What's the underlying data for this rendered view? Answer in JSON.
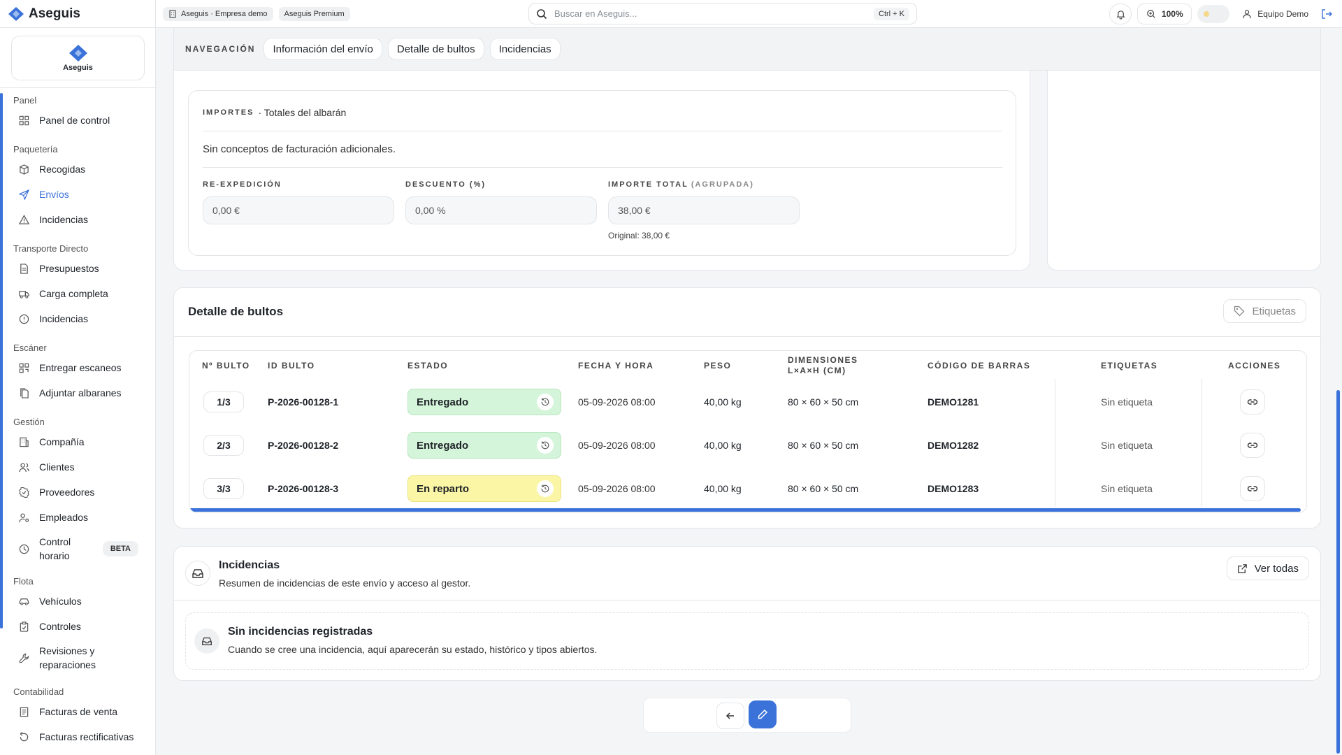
{
  "topbar": {
    "brand": "Aseguis",
    "company_chip": "Aseguis · Empresa demo",
    "plan_chip": "Aseguis Premium",
    "search_placeholder": "Buscar en Aseguis...",
    "search_shortcut": "Ctrl + K",
    "zoom": "100%",
    "user": "Equipo Demo"
  },
  "sidebar": {
    "logo_text": "Aseguis",
    "groups": [
      {
        "label": "Panel",
        "items": [
          "Panel de control"
        ]
      },
      {
        "label": "Paquetería",
        "items": [
          "Recogidas",
          "Envíos",
          "Incidencias"
        ]
      },
      {
        "label": "Transporte Directo",
        "items": [
          "Presupuestos",
          "Carga completa",
          "Incidencias"
        ]
      },
      {
        "label": "Escáner",
        "items": [
          "Entregar escaneos",
          "Adjuntar albaranes"
        ]
      },
      {
        "label": "Gestión",
        "items": [
          "Compañía",
          "Clientes",
          "Proveedores",
          "Empleados",
          "Control horario"
        ]
      },
      {
        "label": "Flota",
        "items": [
          "Vehículos",
          "Controles",
          "Revisiones y reparaciones"
        ]
      },
      {
        "label": "Contabilidad",
        "items": [
          "Facturas de venta",
          "Facturas rectificativas"
        ]
      }
    ],
    "beta_badge": "BETA"
  },
  "nav": {
    "label": "NAVEGACIÓN",
    "tabs": [
      "Información del envío",
      "Detalle de bultos",
      "Incidencias"
    ]
  },
  "importes": {
    "title": "IMPORTES",
    "subtitle": "· Totales del albarán",
    "empty": "Sin conceptos de facturación adicionales.",
    "reexp_label": "RE-EXPEDICIÓN",
    "reexp_value": "0,00 €",
    "descuento_label": "DESCUENTO (%)",
    "descuento_value": "0,00 %",
    "total_label": "IMPORTE TOTAL",
    "total_sub": "(AGRUPADA)",
    "total_value": "38,00 €",
    "original": "Original: 38,00 €"
  },
  "bultos": {
    "title": "Detalle de bultos",
    "labels_button": "Etiquetas",
    "headers": [
      "Nº BULTO",
      "ID BULTO",
      "ESTADO",
      "FECHA Y HORA",
      "PESO",
      "DIMENSIONES L×A×H (CM)",
      "CÓDIGO DE BARRAS",
      "ETIQUETAS",
      "ACCIONES"
    ],
    "rows": [
      {
        "num": "1/3",
        "id": "P-2026-00128-1",
        "estado": "Entregado",
        "fecha": "05-09-2026 08:00",
        "peso": "40,00 kg",
        "dim": "80 × 60 × 50 cm",
        "codigo": "DEMO1281",
        "etiqueta": "Sin etiqueta"
      },
      {
        "num": "2/3",
        "id": "P-2026-00128-2",
        "estado": "Entregado",
        "fecha": "05-09-2026 08:00",
        "peso": "40,00 kg",
        "dim": "80 × 60 × 50 cm",
        "codigo": "DEMO1282",
        "etiqueta": "Sin etiqueta"
      },
      {
        "num": "3/3",
        "id": "P-2026-00128-3",
        "estado": "En reparto",
        "fecha": "05-09-2026 08:00",
        "peso": "40,00 kg",
        "dim": "80 × 60 × 50 cm",
        "codigo": "DEMO1283",
        "etiqueta": "Sin etiqueta"
      }
    ]
  },
  "incidencias": {
    "title": "Incidencias",
    "subtitle": "Resumen de incidencias de este envío y acceso al gestor.",
    "ver_todas": "Ver todas",
    "empty_title": "Sin incidencias registradas",
    "empty_text": "Cuando se cree una incidencia, aquí aparecerán su estado, histórico y tipos abiertos."
  },
  "colors": {
    "accent": "#3b72d9",
    "delivered": "#d4f5d9",
    "in_transit": "#fbf6a6"
  }
}
